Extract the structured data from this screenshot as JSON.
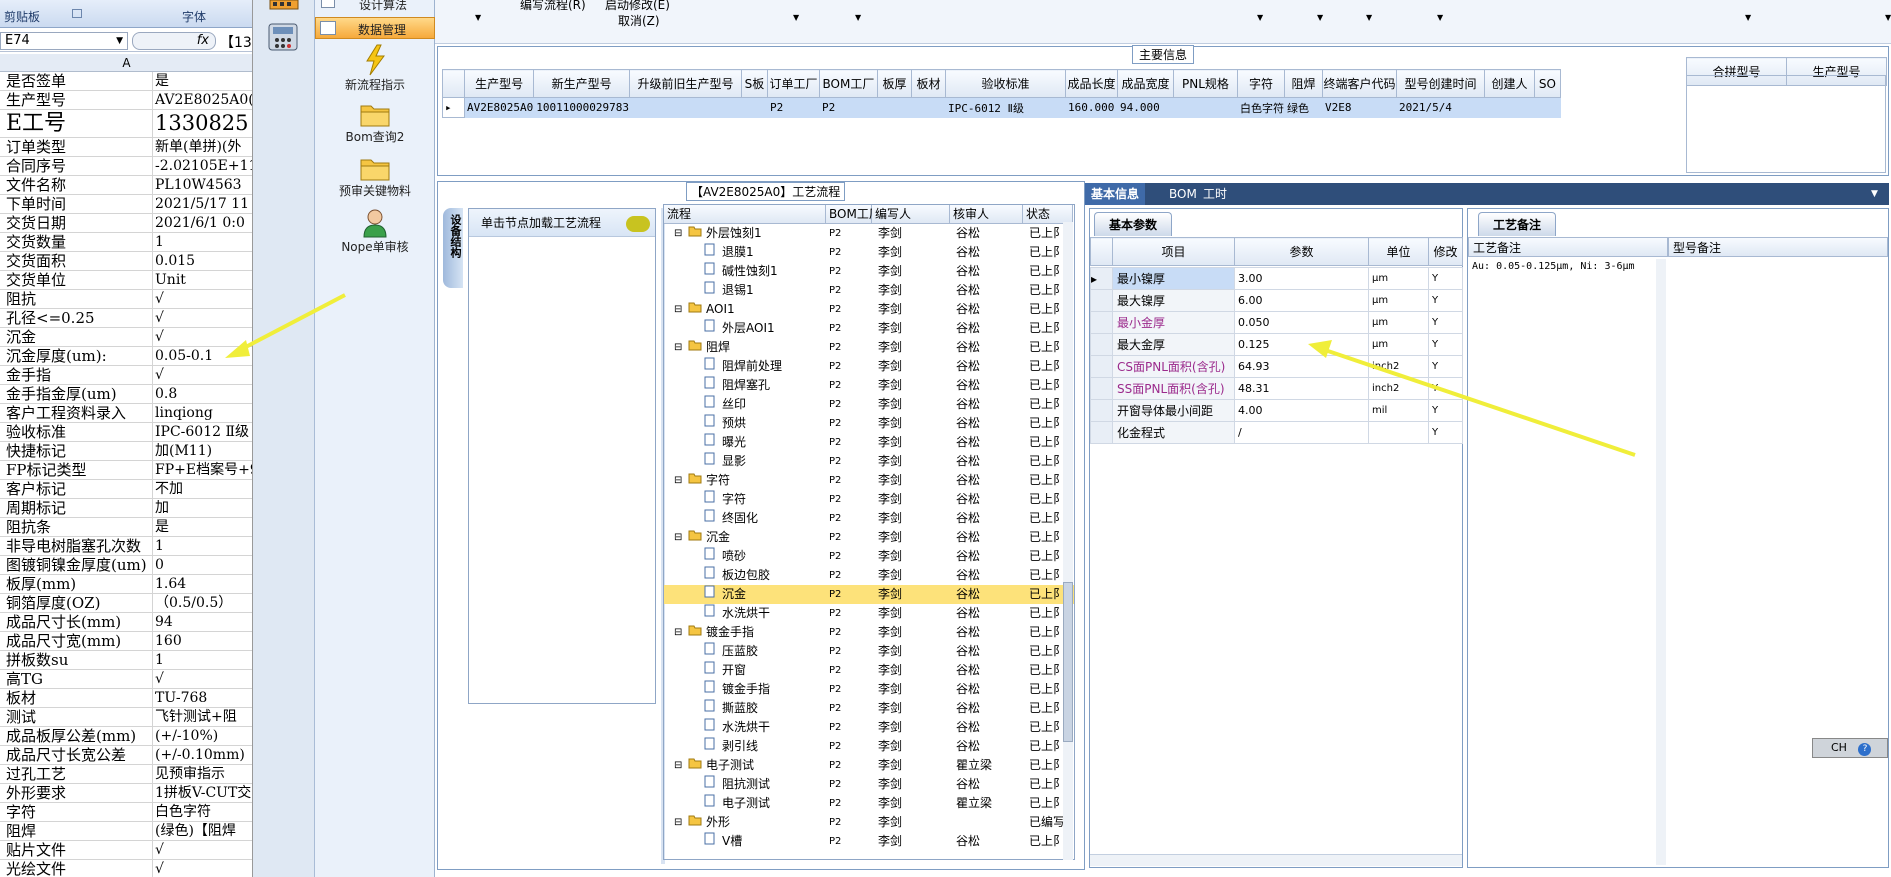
{
  "excel": {
    "ribbon_groups": [
      "剪贴板",
      "字体"
    ],
    "name_box": "E74",
    "fx_label": "fx",
    "formula_value": "【133",
    "col_header": "A",
    "rows": [
      {
        "k": "是否签单",
        "v": "是"
      },
      {
        "k": "生产型号",
        "v": "AV2E8025A0(7"
      },
      {
        "k": "E工号",
        "v": "1330825",
        "tall": true
      },
      {
        "k": "订单类型",
        "v": "新单(单拼)(外"
      },
      {
        "k": "合同序号",
        "v": "-2.02105E+11"
      },
      {
        "k": "文件名称",
        "v": "PL10W4563"
      },
      {
        "k": "下单时间",
        "v": "2021/5/17 11"
      },
      {
        "k": "交货日期",
        "v": "2021/6/1 0:0"
      },
      {
        "k": "交货数量",
        "v": "1"
      },
      {
        "k": "交货面积",
        "v": "0.015"
      },
      {
        "k": "交货单位",
        "v": "Unit"
      },
      {
        "k": "阻抗",
        "v": "√"
      },
      {
        "k": "孔径<=0.25",
        "v": "√"
      },
      {
        "k": "沉金",
        "v": "√"
      },
      {
        "k": "沉金厚度(um):",
        "v": "0.05-0.1"
      },
      {
        "k": "金手指",
        "v": "√"
      },
      {
        "k": "金手指金厚(um)",
        "v": "0.8"
      },
      {
        "k": "客户工程资料录入",
        "v": "linqiong"
      },
      {
        "k": "验收标准",
        "v": "IPC-6012 Ⅱ级"
      },
      {
        "k": "快捷标记",
        "v": "加(M11)"
      },
      {
        "k": "FP标记类型",
        "v": "FP+E档案号+9"
      },
      {
        "k": "客户标记",
        "v": "不加"
      },
      {
        "k": "周期标记",
        "v": "加"
      },
      {
        "k": "阻抗条",
        "v": "是"
      },
      {
        "k": "非导电树脂塞孔次数",
        "v": "1"
      },
      {
        "k": "图镀铜镍金厚度(um)",
        "v": "0"
      },
      {
        "k": "板厚(mm)",
        "v": "1.64"
      },
      {
        "k": "铜箔厚度(OZ)",
        "v": "（0.5/0.5）"
      },
      {
        "k": "成品尺寸长(mm)",
        "v": "94"
      },
      {
        "k": "成品尺寸宽(mm)",
        "v": "160"
      },
      {
        "k": "拼板数su",
        "v": "1"
      },
      {
        "k": "高TG",
        "v": "√"
      },
      {
        "k": "板材",
        "v": "TU-768"
      },
      {
        "k": "测试",
        "v": "飞针测试+阻"
      },
      {
        "k": "成品板厚公差(mm)",
        "v": "(+/-10%)"
      },
      {
        "k": "成品尺寸长宽公差",
        "v": "(+/-0.10mm)"
      },
      {
        "k": "过孔工艺",
        "v": "见预审指示"
      },
      {
        "k": "外形要求",
        "v": "1拼板V-CUT交"
      },
      {
        "k": "字符",
        "v": "白色字符"
      },
      {
        "k": "阻焊",
        "v": "(绿色)【阻焊"
      },
      {
        "k": "贴片文件",
        "v": "√"
      },
      {
        "k": "光绘文件",
        "v": "√"
      }
    ]
  },
  "menu": {
    "top_partial": "设计算法",
    "active": "数据管理",
    "buttons": [
      "新流程指示",
      "Bom查询2",
      "预审关键物料",
      "Nope单审核"
    ]
  },
  "topbar": {
    "lines": [
      "编写流程(R)",
      "启动修改(E)",
      "取消(Z)"
    ]
  },
  "main": {
    "title": "主要信息",
    "headers": [
      "生产型号",
      "新生产型号",
      "升级前旧生产型号",
      "S板",
      "订单工厂",
      "BOM工厂",
      "板厚",
      "板材",
      "验收标准",
      "成品长度",
      "成品宽度",
      "PNL规格",
      "字符",
      "阻焊",
      "终端客户代码",
      "型号创建时间",
      "创建人",
      "SO"
    ],
    "row": [
      "AV2E8025A0",
      "10011000029783",
      "",
      "",
      "P2",
      "P2",
      "",
      "",
      "IPC-6012 Ⅱ级",
      "160.000",
      "94.000",
      "",
      "白色字符",
      "绿色",
      "V2E8",
      "2021/5/4",
      "",
      ""
    ],
    "right_headers": [
      "合拼型号",
      "生产型号"
    ]
  },
  "process": {
    "title": "【AV2E8025A0】工艺流程",
    "side_tab": "设备结构",
    "hint": "单击节点加载工艺流程",
    "headers": [
      "流程",
      "BOM工厂",
      "编写人",
      "核审人",
      "状态"
    ],
    "rows": [
      {
        "n": "外层蚀刻1",
        "lvl": 0,
        "f": "P2",
        "w": "李剑",
        "r": "谷松",
        "s": "已上阝"
      },
      {
        "n": "退膜1",
        "lvl": 1,
        "f": "P2",
        "w": "李剑",
        "r": "谷松",
        "s": "已上阝"
      },
      {
        "n": "碱性蚀刻1",
        "lvl": 1,
        "f": "P2",
        "w": "李剑",
        "r": "谷松",
        "s": "已上阝"
      },
      {
        "n": "退锡1",
        "lvl": 1,
        "f": "P2",
        "w": "李剑",
        "r": "谷松",
        "s": "已上阝"
      },
      {
        "n": "AOI1",
        "lvl": 0,
        "f": "P2",
        "w": "李剑",
        "r": "谷松",
        "s": "已上阝"
      },
      {
        "n": "外层AOI1",
        "lvl": 1,
        "f": "P2",
        "w": "李剑",
        "r": "谷松",
        "s": "已上阝"
      },
      {
        "n": "阻焊",
        "lvl": 0,
        "f": "P2",
        "w": "李剑",
        "r": "谷松",
        "s": "已上阝"
      },
      {
        "n": "阻焊前处理",
        "lvl": 1,
        "f": "P2",
        "w": "李剑",
        "r": "谷松",
        "s": "已上阝"
      },
      {
        "n": "阻焊塞孔",
        "lvl": 1,
        "f": "P2",
        "w": "李剑",
        "r": "谷松",
        "s": "已上阝"
      },
      {
        "n": "丝印",
        "lvl": 1,
        "f": "P2",
        "w": "李剑",
        "r": "谷松",
        "s": "已上阝"
      },
      {
        "n": "预烘",
        "lvl": 1,
        "f": "P2",
        "w": "李剑",
        "r": "谷松",
        "s": "已上阝"
      },
      {
        "n": "曝光",
        "lvl": 1,
        "f": "P2",
        "w": "李剑",
        "r": "谷松",
        "s": "已上阝"
      },
      {
        "n": "显影",
        "lvl": 1,
        "f": "P2",
        "w": "李剑",
        "r": "谷松",
        "s": "已上阝"
      },
      {
        "n": "字符",
        "lvl": 0,
        "f": "P2",
        "w": "李剑",
        "r": "谷松",
        "s": "已上阝"
      },
      {
        "n": "字符",
        "lvl": 1,
        "f": "P2",
        "w": "李剑",
        "r": "谷松",
        "s": "已上阝"
      },
      {
        "n": "终固化",
        "lvl": 1,
        "f": "P2",
        "w": "李剑",
        "r": "谷松",
        "s": "已上阝"
      },
      {
        "n": "沉金",
        "lvl": 0,
        "f": "P2",
        "w": "李剑",
        "r": "谷松",
        "s": "已上阝"
      },
      {
        "n": "喷砂",
        "lvl": 1,
        "f": "P2",
        "w": "李剑",
        "r": "谷松",
        "s": "已上阝"
      },
      {
        "n": "板边包胶",
        "lvl": 1,
        "f": "P2",
        "w": "李剑",
        "r": "谷松",
        "s": "已上阝"
      },
      {
        "n": "沉金",
        "lvl": 1,
        "f": "P2",
        "w": "李剑",
        "r": "谷松",
        "s": "已上阝",
        "sel": true
      },
      {
        "n": "水洗烘干",
        "lvl": 1,
        "f": "P2",
        "w": "李剑",
        "r": "谷松",
        "s": "已上阝"
      },
      {
        "n": "镀金手指",
        "lvl": 0,
        "f": "P2",
        "w": "李剑",
        "r": "谷松",
        "s": "已上阝"
      },
      {
        "n": "压蓝胶",
        "lvl": 1,
        "f": "P2",
        "w": "李剑",
        "r": "谷松",
        "s": "已上阝"
      },
      {
        "n": "开窗",
        "lvl": 1,
        "f": "P2",
        "w": "李剑",
        "r": "谷松",
        "s": "已上阝"
      },
      {
        "n": "镀金手指",
        "lvl": 1,
        "f": "P2",
        "w": "李剑",
        "r": "谷松",
        "s": "已上阝"
      },
      {
        "n": "撕蓝胶",
        "lvl": 1,
        "f": "P2",
        "w": "李剑",
        "r": "谷松",
        "s": "已上阝"
      },
      {
        "n": "水洗烘干",
        "lvl": 1,
        "f": "P2",
        "w": "李剑",
        "r": "谷松",
        "s": "已上阝"
      },
      {
        "n": "剥引线",
        "lvl": 1,
        "f": "P2",
        "w": "李剑",
        "r": "谷松",
        "s": "已上阝"
      },
      {
        "n": "电子测试",
        "lvl": 0,
        "f": "P2",
        "w": "李剑",
        "r": "瞿立梁",
        "s": "已上阝"
      },
      {
        "n": "阻抗测试",
        "lvl": 1,
        "f": "P2",
        "w": "李剑",
        "r": "谷松",
        "s": "已上阝"
      },
      {
        "n": "电子测试",
        "lvl": 1,
        "f": "P2",
        "w": "李剑",
        "r": "瞿立梁",
        "s": "已上阝"
      },
      {
        "n": "外形",
        "lvl": 0,
        "f": "P2",
        "w": "李剑",
        "r": "",
        "s": "已编写"
      },
      {
        "n": "V槽",
        "lvl": 1,
        "f": "P2",
        "w": "李剑",
        "r": "谷松",
        "s": "已上阝"
      }
    ]
  },
  "info": {
    "tabs": [
      "基本信息",
      "BOM",
      "工时"
    ],
    "basic_title": "基本参数",
    "headers": [
      "项目",
      "参数",
      "单位",
      "修改"
    ],
    "rows": [
      {
        "item": "最小镍厚",
        "param": "3.00",
        "unit": "μm",
        "mod": "Y",
        "color": "#000000"
      },
      {
        "item": "最大镍厚",
        "param": "6.00",
        "unit": "μm",
        "mod": "Y",
        "color": "#000000"
      },
      {
        "item": "最小金厚",
        "param": "0.050",
        "unit": "μm",
        "mod": "Y",
        "color": "#9b2a8c"
      },
      {
        "item": "最大金厚",
        "param": "0.125",
        "unit": "μm",
        "mod": "Y",
        "color": "#000000"
      },
      {
        "item": "CS面PNL面积(含孔)",
        "param": "64.93",
        "unit": "inch2",
        "mod": "Y",
        "color": "#9b2a8c"
      },
      {
        "item": "SS面PNL面积(含孔)",
        "param": "48.31",
        "unit": "inch2",
        "mod": "Y",
        "color": "#9b2a8c"
      },
      {
        "item": "开窗导体最小间距",
        "param": "4.00",
        "unit": "mil",
        "mod": "Y",
        "color": "#000000"
      },
      {
        "item": "化金程式",
        "param": "/",
        "unit": "",
        "mod": "Y",
        "color": "#000000"
      }
    ],
    "remark_title": "工艺备注",
    "remark_headers": [
      "工艺备注",
      "型号备注"
    ],
    "remark_text": "Au: 0.05-0.125μm, Ni: 3-6μm"
  },
  "ime": {
    "label": "CH"
  },
  "colors": {
    "arrow": "#f0ee3a",
    "selection": "#fde27a",
    "header_blue": "#2f4e7a"
  }
}
